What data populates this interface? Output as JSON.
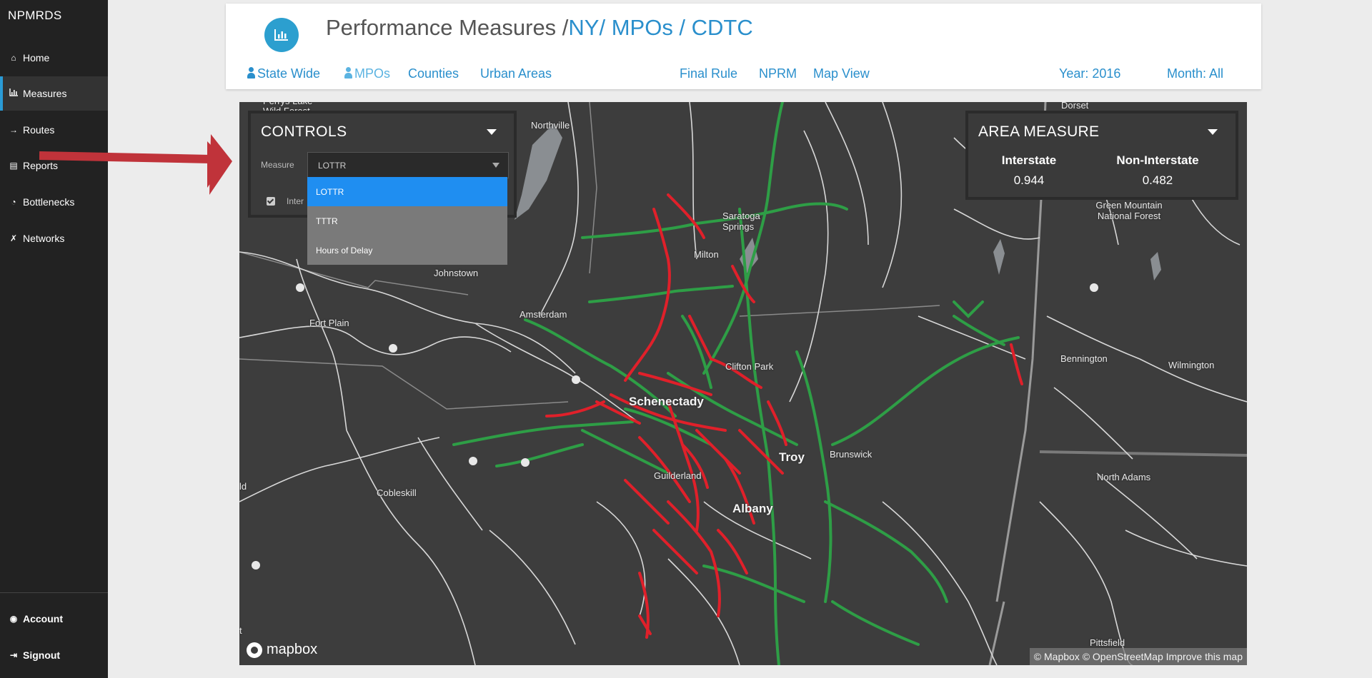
{
  "app": {
    "brand": "NPMRDS"
  },
  "sidebar": {
    "items": [
      {
        "label": "Home",
        "icon": "home-icon"
      },
      {
        "label": "Measures",
        "icon": "bar-chart-icon",
        "active": true
      },
      {
        "label": "Routes",
        "icon": "arrow-right-icon"
      },
      {
        "label": "Reports",
        "icon": "file-icon"
      },
      {
        "label": "Bottlenecks",
        "icon": "dashboard-icon"
      },
      {
        "label": "Networks",
        "icon": "shuffle-icon"
      }
    ],
    "bottom": [
      {
        "label": "Account",
        "icon": "user-circle-icon"
      },
      {
        "label": "Signout",
        "icon": "sign-out-icon"
      }
    ]
  },
  "header": {
    "title_main": "Performance Measures /",
    "breadcrumb": "NY/ MPOs / CDTC",
    "tabs_left": [
      "State Wide",
      "MPOs",
      "Counties",
      "Urban Areas"
    ],
    "tabs_center": [
      "Final Rule",
      "NPRM",
      "Map View"
    ],
    "year": "Year: 2016",
    "month": "Month: All",
    "accent_color": "#2a8fcc"
  },
  "controls": {
    "title": "CONTROLS",
    "measure_label": "Measure",
    "measure_value": "LOTTR",
    "options": [
      "LOTTR",
      "TTTR",
      "Hours of Delay"
    ],
    "checkbox_label": "Inter"
  },
  "area_measure": {
    "title": "AREA MEASURE",
    "interstate_label": "Interstate",
    "interstate_value": "0.944",
    "noninterstate_label": "Non-Interstate",
    "noninterstate_value": "0.482"
  },
  "map": {
    "places": [
      "Dorset",
      "Northville",
      "Perrys Lake Wild Forest",
      "Green Mountain National Forest",
      "Saratoga Springs",
      "Milton",
      "Johnstown",
      "Amsterdam",
      "Fort Plain",
      "Clifton Park",
      "Schenectady",
      "Troy",
      "Brunswick",
      "Bennington",
      "Wilmington",
      "North Adams",
      "Guilderland",
      "Albany",
      "Cobleskill",
      "Pittsfield",
      "ld",
      "t"
    ],
    "attribution": "© Mapbox © OpenStreetMap Improve this map",
    "logo": "mapbox",
    "colors": {
      "good": "#2e9e46",
      "bad": "#e0202a",
      "background": "#3d3d3d"
    }
  }
}
